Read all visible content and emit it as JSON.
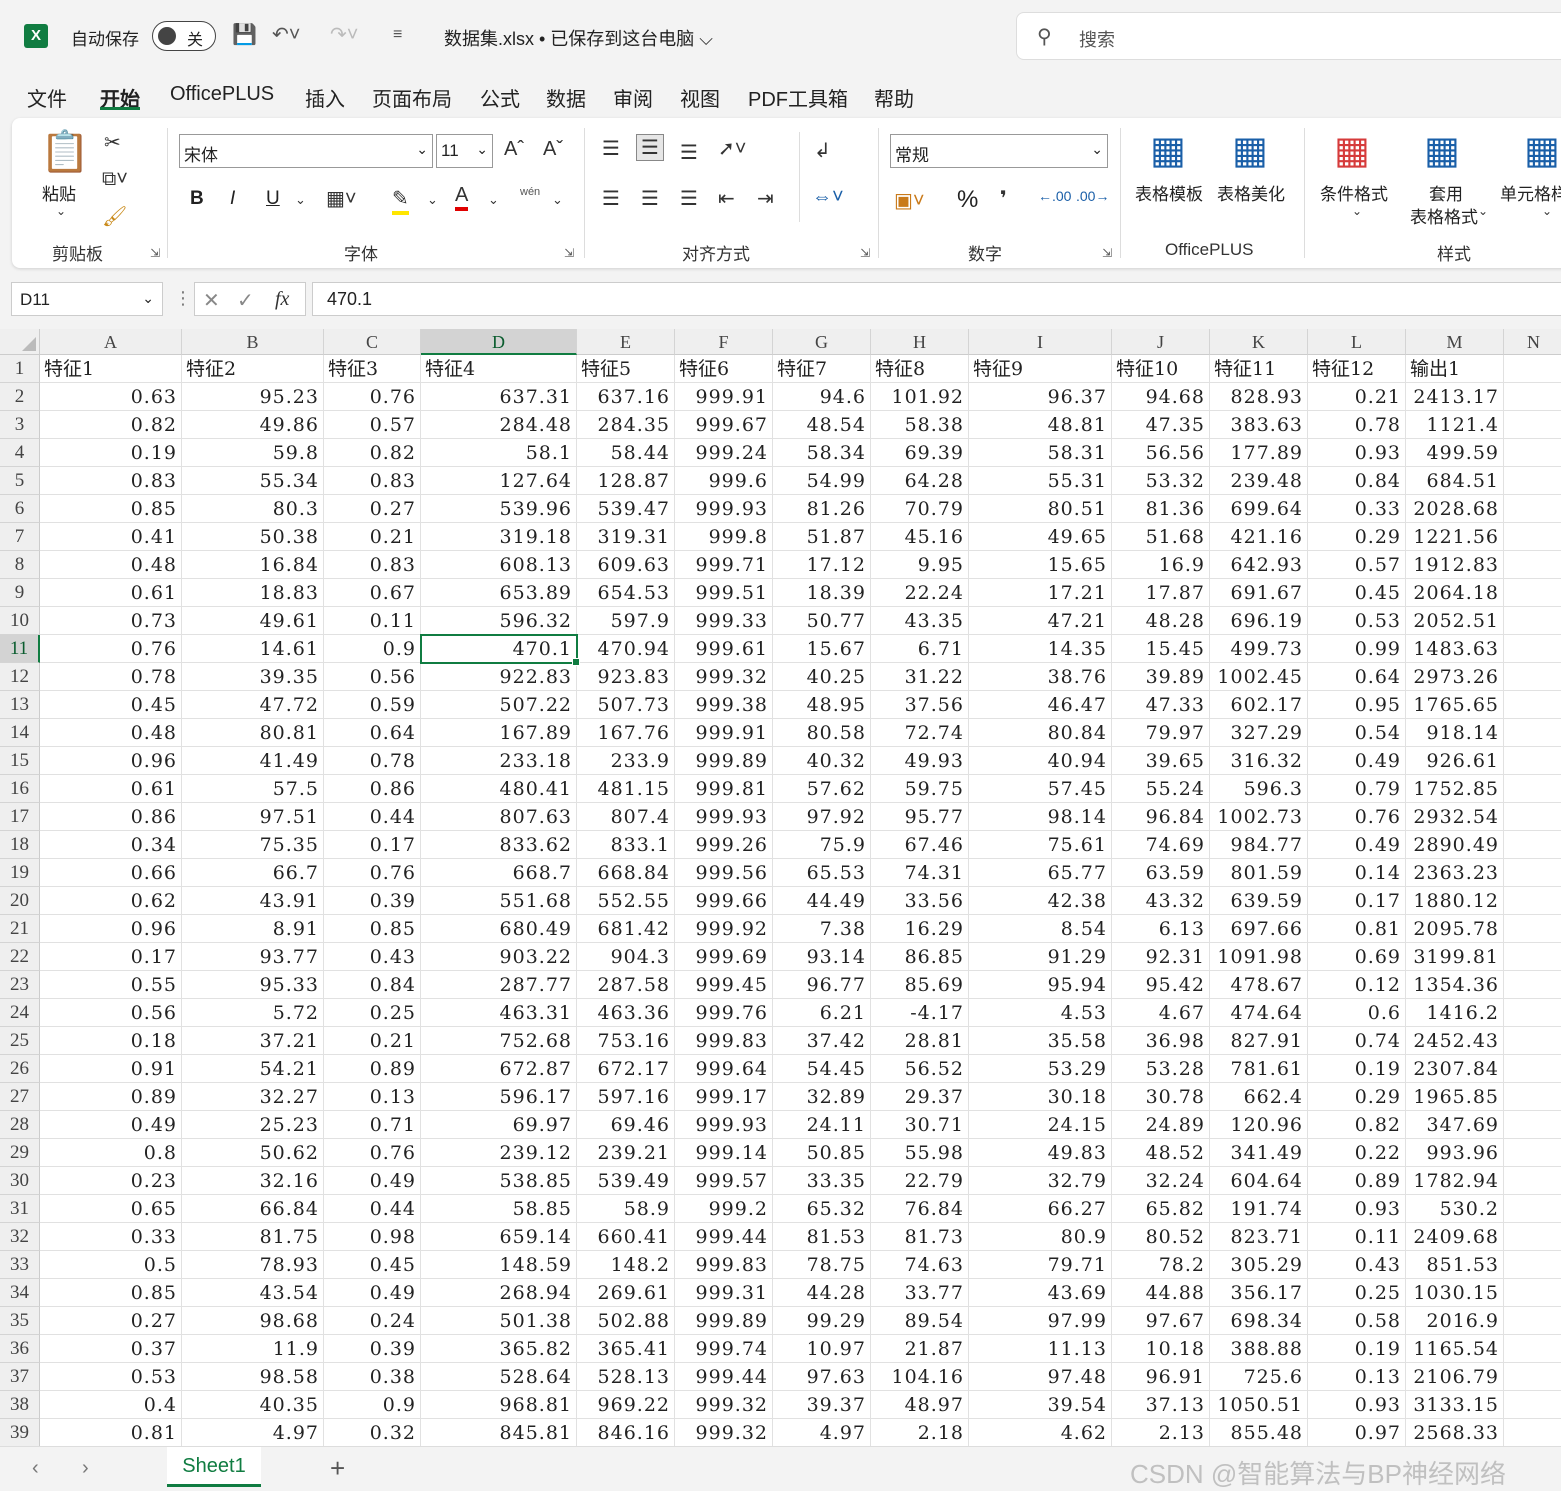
{
  "title_bar": {
    "autosave_label": "自动保存",
    "autosave_state": "关",
    "document_title": "数据集.xlsx • 已保存到这台电脑 ⌵",
    "search_placeholder": "搜索"
  },
  "menu": [
    "文件",
    "开始",
    "OfficePLUS",
    "插入",
    "页面布局",
    "公式",
    "数据",
    "审阅",
    "视图",
    "PDF工具箱",
    "帮助"
  ],
  "active_menu": "开始",
  "ribbon": {
    "clipboard": {
      "label": "剪贴板",
      "paste": "粘贴"
    },
    "font": {
      "label": "字体",
      "font_name": "宋体",
      "font_size": "11",
      "bold": "B",
      "italic": "I",
      "underline": "U",
      "phonetic": "wén"
    },
    "alignment": {
      "label": "对齐方式"
    },
    "number": {
      "label": "数字",
      "format": "常规",
      "percent": "%"
    },
    "officeplus": {
      "label": "OfficePLUS",
      "table_template": "表格模板",
      "table_beautify": "表格美化"
    },
    "styles": {
      "label": "样式",
      "conditional_format": "条件格式",
      "apply_format_line1": "套用",
      "apply_format_line2": "表格格式",
      "cell_style": "单元格样"
    }
  },
  "formula_bar": {
    "name_box": "D11",
    "fx": "fx",
    "content": "470.1"
  },
  "grid": {
    "columns": [
      "A",
      "B",
      "C",
      "D",
      "E",
      "F",
      "G",
      "H",
      "I",
      "J",
      "K",
      "L",
      "M",
      "N"
    ],
    "selected_column": "D",
    "selected_row": "11",
    "header_row": [
      "特征1",
      "特征2",
      "特征3",
      "特征4",
      "特征5",
      "特征6",
      "特征7",
      "特征8",
      "特征9",
      "特征10",
      "特征11",
      "特征12",
      "输出1"
    ],
    "rows": [
      [
        "0.63",
        "95.23",
        "0.76",
        "637.31",
        "637.16",
        "999.91",
        "94.6",
        "101.92",
        "96.37",
        "94.68",
        "828.93",
        "0.21",
        "2413.17"
      ],
      [
        "0.82",
        "49.86",
        "0.57",
        "284.48",
        "284.35",
        "999.67",
        "48.54",
        "58.38",
        "48.81",
        "47.35",
        "383.63",
        "0.78",
        "1121.4"
      ],
      [
        "0.19",
        "59.8",
        "0.82",
        "58.1",
        "58.44",
        "999.24",
        "58.34",
        "69.39",
        "58.31",
        "56.56",
        "177.89",
        "0.93",
        "499.59"
      ],
      [
        "0.83",
        "55.34",
        "0.83",
        "127.64",
        "128.87",
        "999.6",
        "54.99",
        "64.28",
        "55.31",
        "53.32",
        "239.48",
        "0.84",
        "684.51"
      ],
      [
        "0.85",
        "80.3",
        "0.27",
        "539.96",
        "539.47",
        "999.93",
        "81.26",
        "70.79",
        "80.51",
        "81.36",
        "699.64",
        "0.33",
        "2028.68"
      ],
      [
        "0.41",
        "50.38",
        "0.21",
        "319.18",
        "319.31",
        "999.8",
        "51.87",
        "45.16",
        "49.65",
        "51.68",
        "421.16",
        "0.29",
        "1221.56"
      ],
      [
        "0.48",
        "16.84",
        "0.83",
        "608.13",
        "609.63",
        "999.71",
        "17.12",
        "9.95",
        "15.65",
        "16.9",
        "642.93",
        "0.57",
        "1912.83"
      ],
      [
        "0.61",
        "18.83",
        "0.67",
        "653.89",
        "654.53",
        "999.51",
        "18.39",
        "22.24",
        "17.21",
        "17.87",
        "691.67",
        "0.45",
        "2064.18"
      ],
      [
        "0.73",
        "49.61",
        "0.11",
        "596.32",
        "597.9",
        "999.33",
        "50.77",
        "43.35",
        "47.21",
        "48.28",
        "696.19",
        "0.53",
        "2052.51"
      ],
      [
        "0.76",
        "14.61",
        "0.9",
        "470.1",
        "470.94",
        "999.61",
        "15.67",
        "6.71",
        "14.35",
        "15.45",
        "499.73",
        "0.99",
        "1483.63"
      ],
      [
        "0.78",
        "39.35",
        "0.56",
        "922.83",
        "923.83",
        "999.32",
        "40.25",
        "31.22",
        "38.76",
        "39.89",
        "1002.45",
        "0.64",
        "2973.26"
      ],
      [
        "0.45",
        "47.72",
        "0.59",
        "507.22",
        "507.73",
        "999.38",
        "48.95",
        "37.56",
        "46.47",
        "47.33",
        "602.17",
        "0.95",
        "1765.65"
      ],
      [
        "0.48",
        "80.81",
        "0.64",
        "167.89",
        "167.76",
        "999.91",
        "80.58",
        "72.74",
        "80.84",
        "79.97",
        "327.29",
        "0.54",
        "918.14"
      ],
      [
        "0.96",
        "41.49",
        "0.78",
        "233.18",
        "233.9",
        "999.89",
        "40.32",
        "49.93",
        "40.94",
        "39.65",
        "316.32",
        "0.49",
        "926.61"
      ],
      [
        "0.61",
        "57.5",
        "0.86",
        "480.41",
        "481.15",
        "999.81",
        "57.62",
        "59.75",
        "57.45",
        "55.24",
        "596.3",
        "0.79",
        "1752.85"
      ],
      [
        "0.86",
        "97.51",
        "0.44",
        "807.63",
        "807.4",
        "999.93",
        "97.92",
        "95.77",
        "98.14",
        "96.84",
        "1002.73",
        "0.76",
        "2932.54"
      ],
      [
        "0.34",
        "75.35",
        "0.17",
        "833.62",
        "833.1",
        "999.26",
        "75.9",
        "67.46",
        "75.61",
        "74.69",
        "984.77",
        "0.49",
        "2890.49"
      ],
      [
        "0.66",
        "66.7",
        "0.76",
        "668.7",
        "668.84",
        "999.56",
        "65.53",
        "74.31",
        "65.77",
        "63.59",
        "801.59",
        "0.14",
        "2363.23"
      ],
      [
        "0.62",
        "43.91",
        "0.39",
        "551.68",
        "552.55",
        "999.66",
        "44.49",
        "33.56",
        "42.38",
        "43.32",
        "639.59",
        "0.17",
        "1880.12"
      ],
      [
        "0.96",
        "8.91",
        "0.85",
        "680.49",
        "681.42",
        "999.92",
        "7.38",
        "16.29",
        "8.54",
        "6.13",
        "697.66",
        "0.81",
        "2095.78"
      ],
      [
        "0.17",
        "93.77",
        "0.43",
        "903.22",
        "904.3",
        "999.69",
        "93.14",
        "86.85",
        "91.29",
        "92.31",
        "1091.98",
        "0.69",
        "3199.81"
      ],
      [
        "0.55",
        "95.33",
        "0.84",
        "287.77",
        "287.58",
        "999.45",
        "96.77",
        "85.69",
        "95.94",
        "95.42",
        "478.67",
        "0.12",
        "1354.36"
      ],
      [
        "0.56",
        "5.72",
        "0.25",
        "463.31",
        "463.36",
        "999.76",
        "6.21",
        "-4.17",
        "4.53",
        "4.67",
        "474.64",
        "0.6",
        "1416.2"
      ],
      [
        "0.18",
        "37.21",
        "0.21",
        "752.68",
        "753.16",
        "999.83",
        "37.42",
        "28.81",
        "35.58",
        "36.98",
        "827.91",
        "0.74",
        "2452.43"
      ],
      [
        "0.91",
        "54.21",
        "0.89",
        "672.87",
        "672.17",
        "999.64",
        "54.45",
        "56.52",
        "53.29",
        "53.28",
        "781.61",
        "0.19",
        "2307.84"
      ],
      [
        "0.89",
        "32.27",
        "0.13",
        "596.17",
        "597.16",
        "999.17",
        "32.89",
        "29.37",
        "30.18",
        "30.78",
        "662.4",
        "0.29",
        "1965.85"
      ],
      [
        "0.49",
        "25.23",
        "0.71",
        "69.97",
        "69.46",
        "999.93",
        "24.11",
        "30.71",
        "24.15",
        "24.89",
        "120.96",
        "0.82",
        "347.69"
      ],
      [
        "0.8",
        "50.62",
        "0.76",
        "239.12",
        "239.21",
        "999.14",
        "50.85",
        "55.98",
        "49.83",
        "48.52",
        "341.49",
        "0.22",
        "993.96"
      ],
      [
        "0.23",
        "32.16",
        "0.49",
        "538.85",
        "539.49",
        "999.57",
        "33.35",
        "22.79",
        "32.79",
        "32.24",
        "604.64",
        "0.89",
        "1782.94"
      ],
      [
        "0.65",
        "66.84",
        "0.44",
        "58.85",
        "58.9",
        "999.2",
        "65.32",
        "76.84",
        "66.27",
        "65.82",
        "191.74",
        "0.93",
        "530.2"
      ],
      [
        "0.33",
        "81.75",
        "0.98",
        "659.14",
        "660.41",
        "999.44",
        "81.53",
        "81.73",
        "80.9",
        "80.52",
        "823.71",
        "0.11",
        "2409.68"
      ],
      [
        "0.5",
        "78.93",
        "0.45",
        "148.59",
        "148.2",
        "999.83",
        "78.75",
        "74.63",
        "79.71",
        "78.2",
        "305.29",
        "0.43",
        "851.53"
      ],
      [
        "0.85",
        "43.54",
        "0.49",
        "268.94",
        "269.61",
        "999.31",
        "44.28",
        "33.77",
        "43.69",
        "44.88",
        "356.17",
        "0.25",
        "1030.15"
      ],
      [
        "0.27",
        "98.68",
        "0.24",
        "501.38",
        "502.88",
        "999.89",
        "99.29",
        "89.54",
        "97.99",
        "97.67",
        "698.34",
        "0.58",
        "2016.9"
      ],
      [
        "0.37",
        "11.9",
        "0.39",
        "365.82",
        "365.41",
        "999.74",
        "10.97",
        "21.87",
        "11.13",
        "10.18",
        "388.88",
        "0.19",
        "1165.54"
      ],
      [
        "0.53",
        "98.58",
        "0.38",
        "528.64",
        "528.13",
        "999.44",
        "97.63",
        "104.16",
        "97.48",
        "96.91",
        "725.6",
        "0.13",
        "2106.79"
      ],
      [
        "0.4",
        "40.35",
        "0.9",
        "968.81",
        "969.22",
        "999.32",
        "39.37",
        "48.97",
        "39.54",
        "37.13",
        "1050.51",
        "0.93",
        "3133.15"
      ],
      [
        "0.81",
        "4.97",
        "0.32",
        "845.81",
        "846.16",
        "999.32",
        "4.97",
        "2.18",
        "4.62",
        "2.13",
        "855.48",
        "0.97",
        "2568.33"
      ]
    ]
  },
  "status": {
    "sheet_tab": "Sheet1",
    "add_sheet": "+",
    "watermark": "CSDN @智能算法与BP神经网络"
  }
}
